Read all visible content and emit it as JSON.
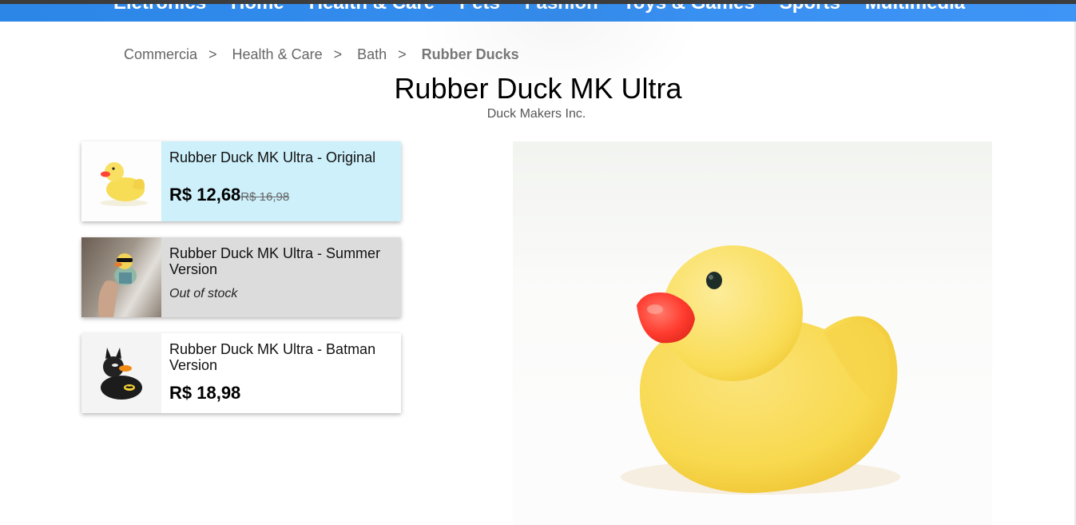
{
  "nav": {
    "items": [
      "Eletronics",
      "Home",
      "Health & Care",
      "Pets",
      "Fashion",
      "Toys & Games",
      "Sports",
      "Multimedia"
    ]
  },
  "breadcrumb": {
    "items": [
      "Commercia",
      "Health & Care",
      "Bath"
    ],
    "current": "Rubber Ducks",
    "separator": ">"
  },
  "product": {
    "title": "Rubber Duck MK Ultra",
    "brand": "Duck Makers Inc."
  },
  "variants": [
    {
      "name": "Rubber Duck MK Ultra - Original",
      "price": "R$ 12,68",
      "old_price": "R$ 16,98",
      "image": "yellow-rubber-duck",
      "selected": true
    },
    {
      "name": "Rubber Duck MK Ultra - Summer Version",
      "stock": "Out of stock",
      "image": "summer-duck-sunglasses"
    },
    {
      "name": "Rubber Duck MK Ultra - Batman Version",
      "price": "R$ 18,98",
      "image": "batman-duck"
    }
  ],
  "colors": {
    "nav_bg": "#3a8ff0",
    "selected_card": "#cdf0fb",
    "out_of_stock_card": "#dcdcdc",
    "duck_yellow": "#f9de5a",
    "beak": "#ff3b2e"
  }
}
